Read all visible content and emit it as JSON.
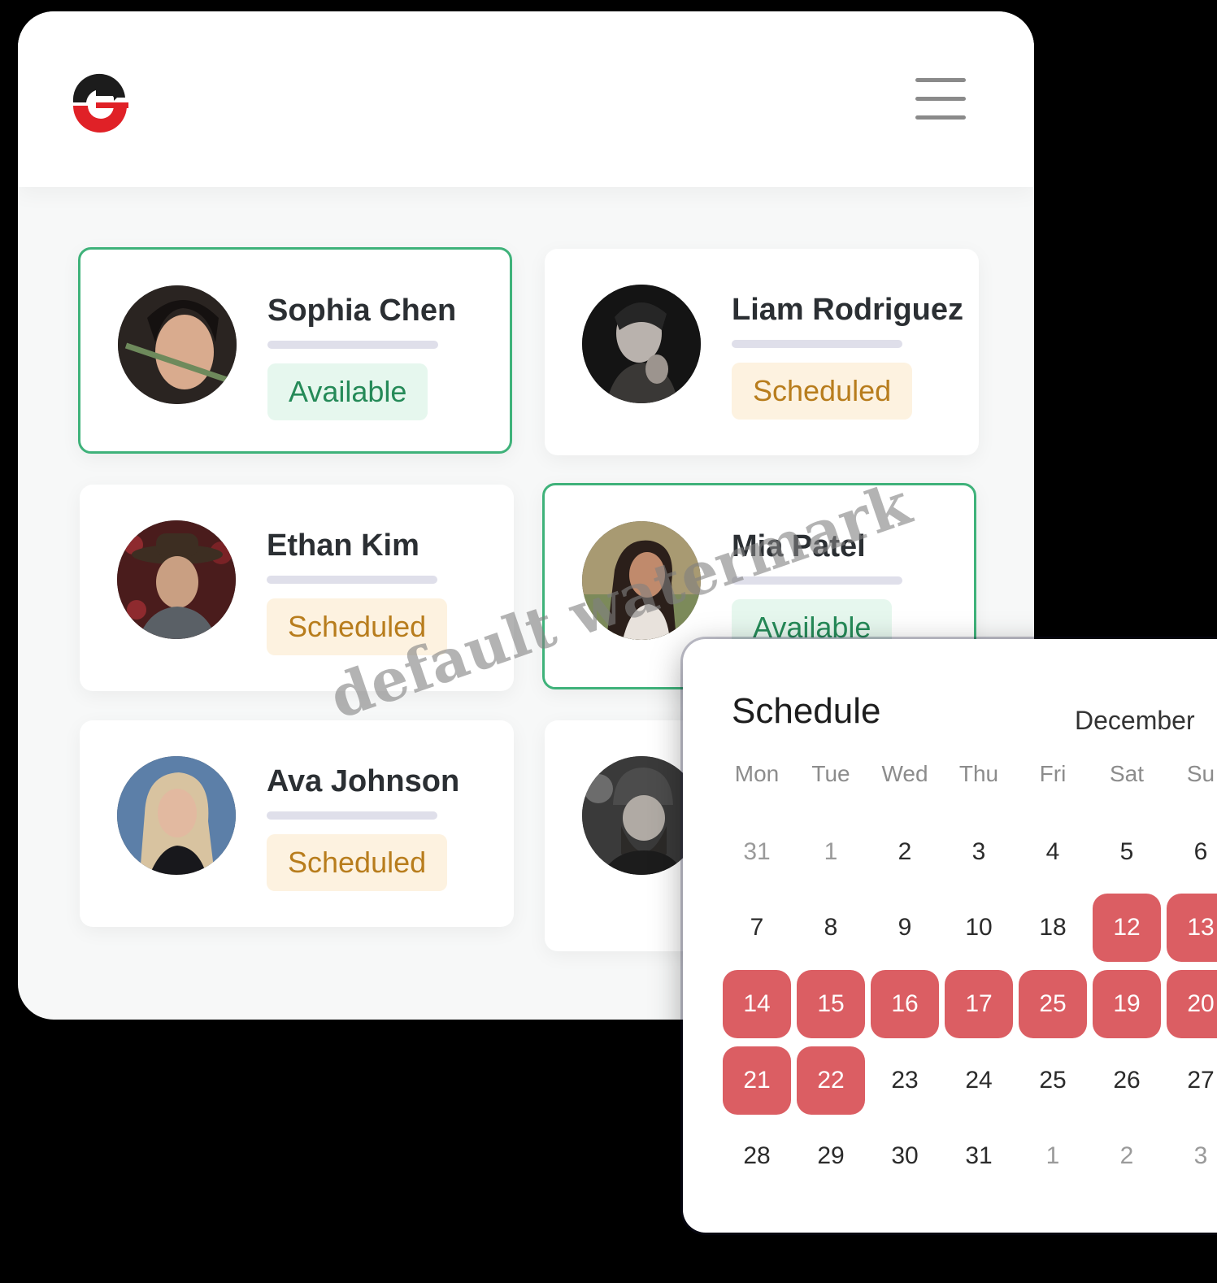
{
  "staff": [
    {
      "name": "Sophia Chen",
      "status": "Available"
    },
    {
      "name": "Liam Rodriguez",
      "status": "Scheduled"
    },
    {
      "name": "Ethan Kim",
      "status": "Scheduled"
    },
    {
      "name": "Mia Patel",
      "status": "Available"
    },
    {
      "name": "Ava Johnson",
      "status": "Scheduled"
    },
    {
      "name": "",
      "status": ""
    }
  ],
  "schedule": {
    "title": "Schedule",
    "month": "December",
    "weekdays": [
      "Mon",
      "Tue",
      "Wed",
      "Thu",
      "Fri",
      "Sat",
      "Su"
    ],
    "weeks": [
      [
        "31",
        "1",
        "2",
        "3",
        "4",
        "5",
        "6"
      ],
      [
        "7",
        "8",
        "9",
        "10",
        "18",
        "12",
        "13"
      ],
      [
        "14",
        "15",
        "16",
        "17",
        "25",
        "19",
        "20"
      ],
      [
        "21",
        "22",
        "23",
        "24",
        "25",
        "26",
        "27"
      ],
      [
        "28",
        "29",
        "30",
        "31",
        "1",
        "2",
        "3"
      ]
    ],
    "selected_days": [
      "12",
      "13",
      "14",
      "15",
      "16",
      "17",
      "25 (week 3)",
      "19",
      "20",
      "21",
      "22"
    ],
    "selected_color": "#db5e63"
  },
  "colors": {
    "available_text": "#258a58",
    "available_bg": "#e6f7ee",
    "scheduled_text": "#b87d1d",
    "scheduled_bg": "#fdf2e0",
    "selected_border": "#3fb27a"
  },
  "watermark": "default watermark"
}
